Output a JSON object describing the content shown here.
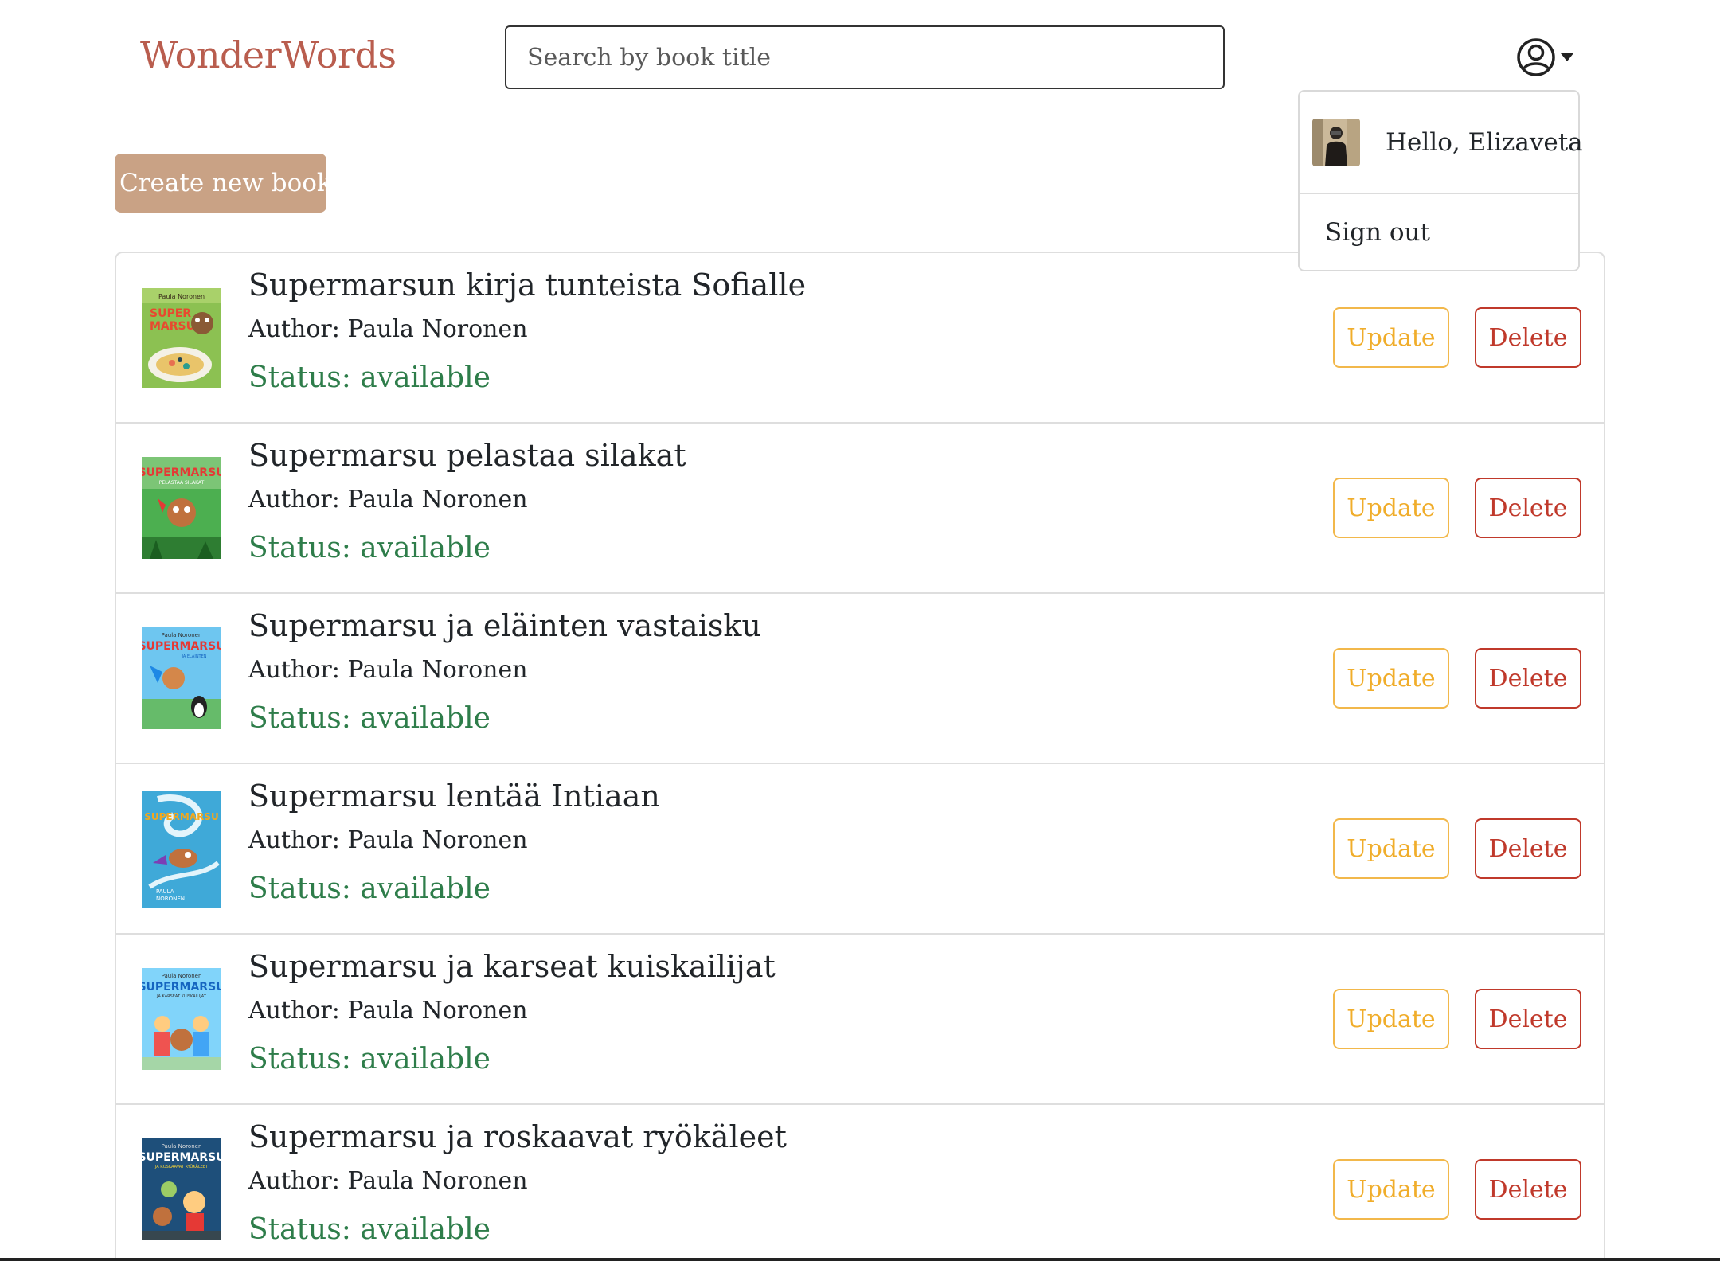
{
  "header": {
    "brand": "WonderWords",
    "search_placeholder": "Search by book title",
    "user_menu_icon": "user-circle-icon"
  },
  "user_menu": {
    "greeting": "Hello, Elizaveta",
    "sign_out": "Sign out"
  },
  "actions": {
    "create_label": "Create new book"
  },
  "book_actions": {
    "update_label": "Update",
    "delete_label": "Delete"
  },
  "colors": {
    "brand": "#b95d4e",
    "create_button": "#c9a285",
    "status": "#2e7d4a",
    "update": "#f0ad2b",
    "delete": "#c0392b"
  },
  "books": [
    {
      "title": "Supermarsun kirja tunteista Sofialle",
      "author": "Author: Paula Noronen",
      "status": "Status: available"
    },
    {
      "title": "Supermarsu pelastaa silakat",
      "author": "Author: Paula Noronen",
      "status": "Status: available"
    },
    {
      "title": "Supermarsu ja eläinten vastaisku",
      "author": "Author: Paula Noronen",
      "status": "Status: available"
    },
    {
      "title": "Supermarsu lentää Intiaan",
      "author": "Author: Paula Noronen",
      "status": "Status: available"
    },
    {
      "title": "Supermarsu ja karseat kuiskailijat",
      "author": "Author: Paula Noronen",
      "status": "Status: available"
    },
    {
      "title": "Supermarsu ja roskaavat ryökäleet",
      "author": "Author: Paula Noronen",
      "status": "Status: available"
    }
  ]
}
